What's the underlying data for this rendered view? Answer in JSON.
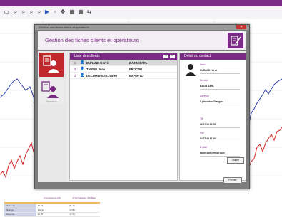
{
  "background_app": {
    "toolbar_icons": [
      "a",
      "a",
      "a",
      "a",
      "cursor",
      "zoom",
      "square",
      "grid",
      "grid",
      "arrows"
    ],
    "table": {
      "headers": [
        "",
        "a°Consommé (W)",
        "a°Température (W) Réel"
      ],
      "rows": [
        [
          "Maximum",
          "22.71",
          "51.41"
        ],
        [
          "Minimum",
          "122.22",
          "23.85"
        ],
        [
          "Moyenne",
          "32.25",
          "17.26"
        ]
      ]
    }
  },
  "window": {
    "titlebar": "Gestion des fiches clients et opérateurs",
    "header_title": "Gestion des fiches clients et opérateurs",
    "nav": {
      "active_label": "",
      "inactive_label": "Opérateurs"
    },
    "clients_panel": {
      "title": "Liste des clients",
      "add_label": "+",
      "del_label": "–",
      "rows": [
        {
          "num": "1",
          "name": "DURAND Hervé",
          "company": "BAZIN SARL"
        },
        {
          "num": "2",
          "name": "TAUPIN Jean",
          "company": "PROCUB"
        },
        {
          "num": "3",
          "name": "DECUMERES Charles",
          "company": "EXPERTO"
        }
      ]
    },
    "detail_panel": {
      "title": "Détail du contact",
      "fields": [
        {
          "label": "Nom",
          "value": "DURAND Hervé"
        },
        {
          "label": "Société",
          "value": "BAZIN SARL"
        },
        {
          "label": "Adresse",
          "value": "5 place des Orangers"
        },
        {
          "label": "Tél",
          "value": "06 12 34 56 78"
        },
        {
          "label": "Fax",
          "value": "04 72 48 87 60"
        },
        {
          "label": "E-Mail",
          "value": "bazin.sarl@email.com"
        }
      ],
      "valider_label": "Valider"
    },
    "close_button_label": "Fermer"
  },
  "colors": {
    "accent": "#7b2a86",
    "active_nav": "#c0282c",
    "chart_red": "#d22323",
    "chart_blue": "#2a3ea8"
  }
}
